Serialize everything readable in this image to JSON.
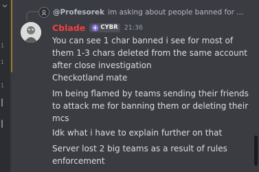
{
  "sidebar": {
    "ticks": [
      "1",
      "1",
      "1"
    ]
  },
  "reply": {
    "author": "@Profesorek",
    "text": "im asking about people banned for ..."
  },
  "message": {
    "author": "Cblade",
    "tag": "CYBR",
    "time": "21:36",
    "lines": [
      "You can see 1 char banned i see for most of them 1-3 chars deleted from the same account after close investigation",
      "Checkotland mate",
      "Im being flamed by teams sending their friends to attack me for banning them or deleting their mcs",
      "Idk what i have to explain further on that",
      "Server lost 2 big teams as a result of rules enforcement"
    ]
  },
  "colors": {
    "author": "#f23f42",
    "background": "#313338",
    "highlight": "#3a3c42",
    "accent": "#a07a2a"
  }
}
